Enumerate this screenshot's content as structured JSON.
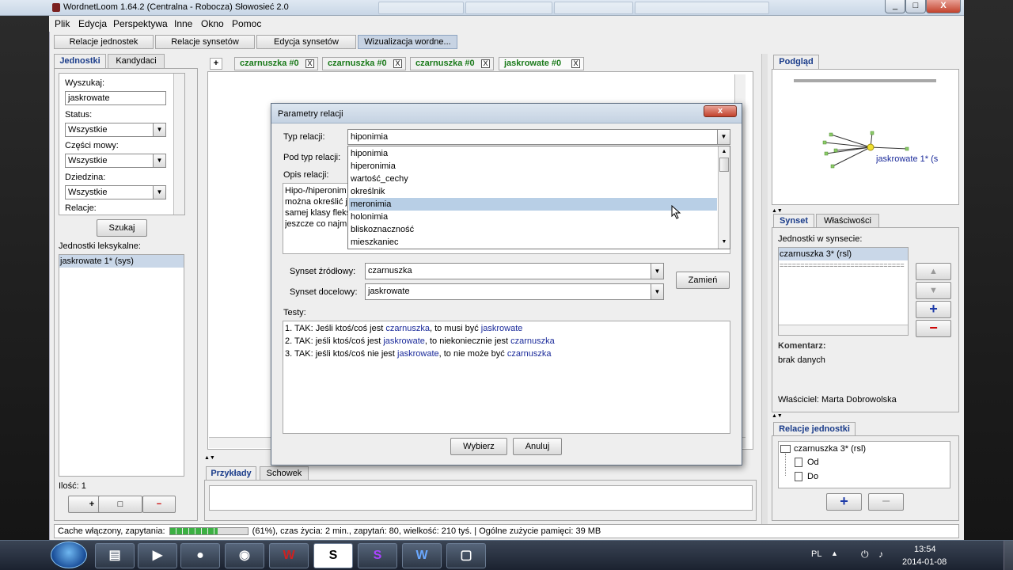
{
  "window": {
    "title": "WordnetLoom 1.64.2 (Centralna - Robocza) Słowosieć 2.0",
    "min": "_",
    "max": "□",
    "close": "X"
  },
  "menu": [
    "Plik",
    "Edycja",
    "Perspektywa",
    "Inne",
    "Okno",
    "Pomoc"
  ],
  "toolbar": {
    "tabs": [
      "Relacje jednostek",
      "Relacje synsetów",
      "Edycja synsetów",
      "Wizualizacja wordne..."
    ]
  },
  "left": {
    "tabs": [
      "Jednostki",
      "Kandydaci"
    ],
    "search_label": "Wyszukaj:",
    "search_value": "jaskrowate",
    "status_label": "Status:",
    "status_value": "Wszystkie",
    "pos_label": "Części mowy:",
    "pos_value": "Wszystkie",
    "domain_label": "Dziedzina:",
    "domain_value": "Wszystkie",
    "relations_label": "Relacje:",
    "search_button": "Szukaj",
    "units_label": "Jednostki leksykalne:",
    "units": [
      "jaskrowate 1* (sys)"
    ],
    "count_label": "Ilość: 1",
    "add_icon": "+",
    "square_icon": "□",
    "remove_icon": "−"
  },
  "center": {
    "add_tab": "+",
    "tabs": [
      "czarnuszka #0",
      "czarnuszka #0",
      "czarnuszka #0",
      "jaskrowate #0"
    ],
    "tab_close": "X",
    "bottom_tabs": [
      "Przykłady",
      "Schowek"
    ]
  },
  "dialog": {
    "title": "Parametry relacji",
    "close": "x",
    "type_label": "Typ relacji:",
    "type_value": "hiponimia",
    "subtype_label": "Pod typ relacji:",
    "desc_label": "Opis relacji:",
    "desc_lines": [
      "Hipo-/hiperonim",
      "można określić j",
      "samej klasy fleks",
      "jeszcze co najm"
    ],
    "dropdown_items": [
      "hiponimia",
      "hiperonimia",
      "wartość_cechy",
      "określnik",
      "meronimia",
      "holonimia",
      "bliskoznaczność",
      "mieszkaniec"
    ],
    "selected_index": 4,
    "source_label": "Synset źródłowy:",
    "source_value": "czarnuszka",
    "target_label": "Synset docelowy:",
    "target_value": "jaskrowate",
    "swap_button": "Zamień",
    "tests_label": "Testy:",
    "tests": [
      {
        "prefix": "1. TAK: Jeśli ktoś/coś jest ",
        "a": "czarnuszka",
        "mid": ", to musi być ",
        "b": "jaskrowate"
      },
      {
        "prefix": "2. TAK: jeśli ktoś/coś jest ",
        "a": "jaskrowate",
        "mid": ", to niekoniecznie jest ",
        "b": "czarnuszka"
      },
      {
        "prefix": "3. TAK: jeśli ktoś/coś nie jest ",
        "a": "jaskrowate",
        "mid": ", to nie może być ",
        "b": "czarnuszka"
      }
    ],
    "ok_button": "Wybierz",
    "cancel_button": "Anuluj"
  },
  "right": {
    "preview_tab": "Podgląd",
    "preview_node_label": "jaskrowate 1* (s",
    "synset_tabs": [
      "Synset",
      "Właściwości"
    ],
    "units_in_synset_label": "Jednostki w synsecie:",
    "units_in_synset": [
      "czarnuszka 3* (rsl)"
    ],
    "separator": "==============================",
    "up_icon": "▲",
    "down_icon": "▼",
    "add_icon": "+",
    "remove_icon": "−",
    "comment_label": "Komentarz:",
    "comment_value": "brak danych",
    "owners_label": "Właściciel: Marta Dobrowolska",
    "unit_relations_tab": "Relacje jednostki",
    "tree_root": "czarnuszka 3* (rsl)",
    "tree_children": [
      "Od",
      "Do"
    ]
  },
  "statusbar": {
    "prefix": "Cache włączony, zapytania:",
    "progress": 0.61,
    "suffix": "(61%), czas życia: 2 min., zapytań: 80, wielkość: 210 tyś. | Ogólne zużycie pamięci: 39 MB"
  },
  "taskbar": {
    "lang": "PL",
    "time": "13:54",
    "date": "2014-01-08"
  }
}
